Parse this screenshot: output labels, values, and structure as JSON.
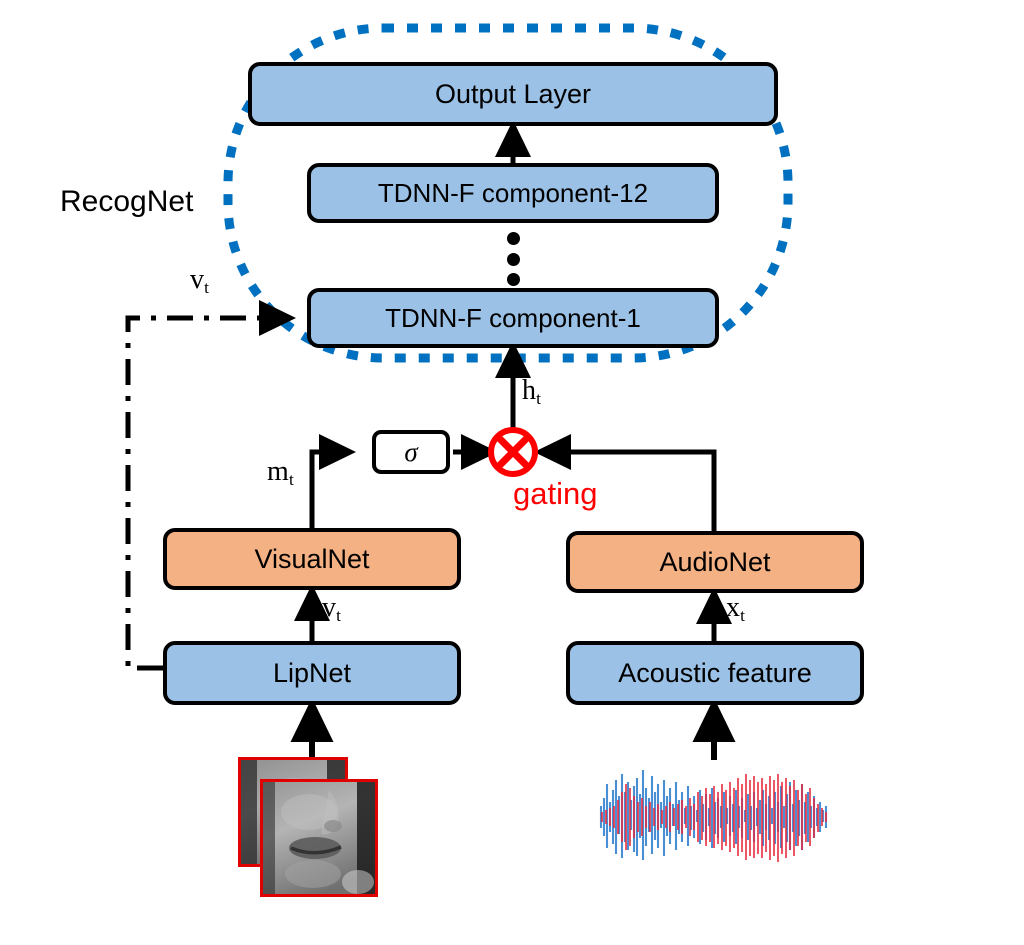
{
  "figure": {
    "title": "Audio-visual speech recognition architecture with gating",
    "type": "architecture-diagram"
  },
  "colors": {
    "box_blue": "#9BC2E6",
    "box_orange": "#F4B183",
    "boundary_blue": "#0070C0",
    "gating_red": "#FF0000",
    "thumb_border_red": "#E00000",
    "waveform_blue": "#4A8FD4",
    "waveform_red": "#E8293C",
    "outline_black": "#000000"
  },
  "group": {
    "recognet_label": "RecogNet"
  },
  "nodes": {
    "output_layer": "Output Layer",
    "tdnnf_12": "TDNN-F component-12",
    "tdnnf_1": "TDNN-F component-1",
    "visualnet": "VisualNet",
    "audionet": "AudioNet",
    "lipnet": "LipNet",
    "acoustic_feature": "Acoustic feature",
    "sigma": "σ"
  },
  "signals": {
    "v_t_feedback": "v",
    "v_t_feedback_sub": "t",
    "h_t": "h",
    "h_t_sub": "t",
    "m_t": "m",
    "m_t_sub": "t",
    "v_t_visual": "v",
    "v_t_visual_sub": "t",
    "x_t": "x",
    "x_t_sub": "t"
  },
  "annotations": {
    "gating": "gating"
  },
  "ellipsis": {
    "dot_count": 3
  },
  "inputs": {
    "visual_thumbnails": 2,
    "audio_waveform_series": 2
  }
}
